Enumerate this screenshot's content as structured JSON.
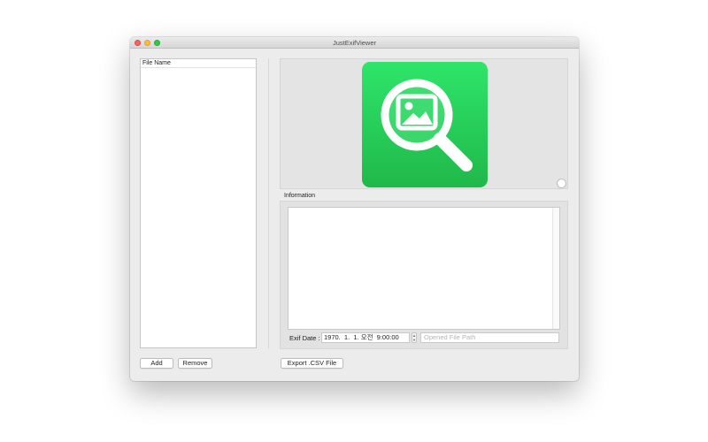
{
  "window": {
    "title": "JustExifViewer"
  },
  "file_list": {
    "column_header": "File Name"
  },
  "information": {
    "label": "Information"
  },
  "exif": {
    "label": "Exif Date :",
    "date_value": "1970.  1.  1. 오전  9:00:00",
    "path_placeholder": "Opened File Path"
  },
  "buttons": {
    "add": "Add",
    "remove": "Remove",
    "export": "Export .CSV File"
  },
  "colors": {
    "icon_green_top": "#2ee56a",
    "icon_green_bottom": "#20b84a"
  }
}
